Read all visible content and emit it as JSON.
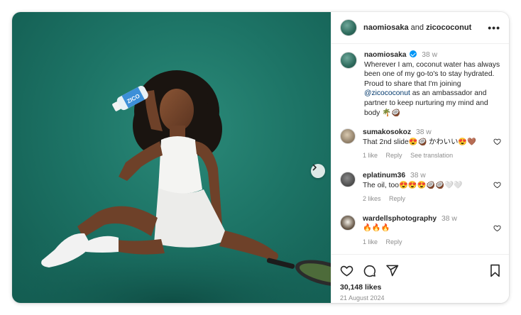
{
  "header": {
    "user1": "naomiosaka",
    "joiner": "and",
    "user2": "zicococonut",
    "more_icon": "more-horizontal-icon"
  },
  "caption": {
    "username": "naomiosaka",
    "time": "38 w",
    "text_before": "Wherever I am, coconut water has always been one of my go-to's to stay hydrated. Proud to share that I'm joining ",
    "mention": "@zicococonut",
    "text_after": " as an ambassador and partner to keep nurturing my mind and body 🌴🥥"
  },
  "comments": [
    {
      "username": "sumakosokoz",
      "time": "38 w",
      "text": "That 2nd slide😍🥥 かわいい😍🤎",
      "likes": "1 like",
      "reply": "Reply",
      "extra": "See translation"
    },
    {
      "username": "eplatinum36",
      "time": "38 w",
      "text": "The oil, too😍😍😍🥥🥥🤍🤍",
      "likes": "2 likes",
      "reply": "Reply",
      "extra": ""
    },
    {
      "username": "wardellsphotography",
      "time": "38 w",
      "text": "🔥🔥🔥",
      "likes": "1 like",
      "reply": "Reply",
      "extra": ""
    }
  ],
  "footer": {
    "likes": "30,148 likes",
    "date": "21 August 2024"
  },
  "photo": {
    "bottle_text": "ZICO"
  },
  "colors": {
    "background": "#1d7466",
    "link": "#00376b",
    "verified": "#0095f6",
    "muted": "#8e8e8e"
  }
}
